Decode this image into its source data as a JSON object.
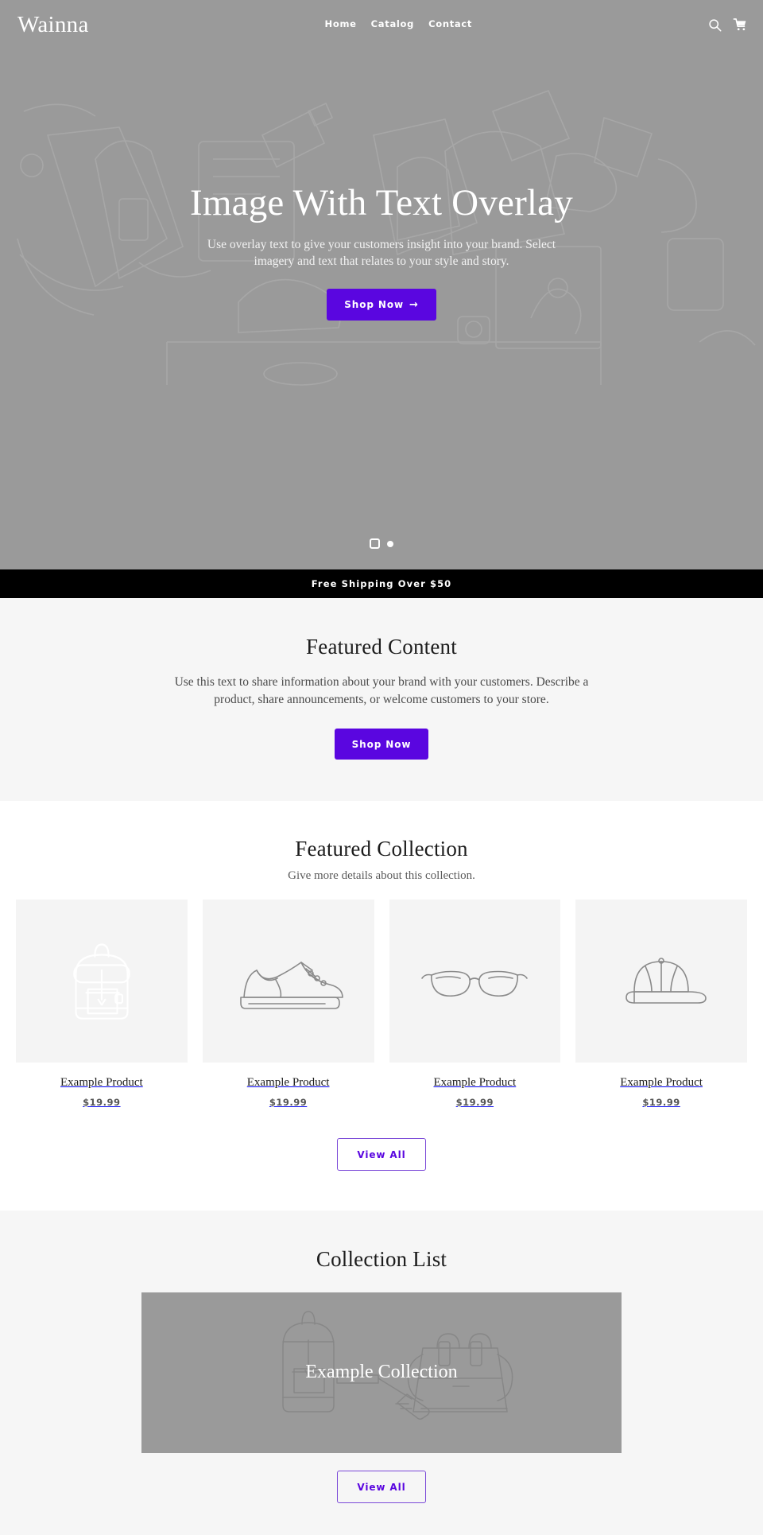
{
  "header": {
    "logo": "Wainna",
    "nav": [
      {
        "label": "Home",
        "name": "nav-link-home"
      },
      {
        "label": "Catalog",
        "name": "nav-link-catalog"
      },
      {
        "label": "Contact",
        "name": "nav-link-contact"
      }
    ],
    "search_icon": "search-icon",
    "cart_icon": "cart-icon"
  },
  "hero": {
    "title": "Image With Text Overlay",
    "subtitle": "Use overlay text to give your customers insight into your brand. Select imagery and text that relates to your style and story.",
    "cta_label": "Shop Now",
    "cta_arrow": "→",
    "slide_indicators": [
      "slide-1",
      "slide-2"
    ],
    "active_slide": 2
  },
  "announcement": {
    "text": "Free Shipping Over $50"
  },
  "featured_content": {
    "title": "Featured Content",
    "body": "Use this text to share information about your brand with your customers. Describe a product, share announcements, or welcome customers to your store.",
    "cta_label": "Shop Now"
  },
  "featured_collection": {
    "title": "Featured Collection",
    "subtitle": "Give more details about this collection.",
    "products": [
      {
        "title": "Example Product",
        "price": "$19.99",
        "art": "backpack"
      },
      {
        "title": "Example Product",
        "price": "$19.99",
        "art": "sneaker"
      },
      {
        "title": "Example Product",
        "price": "$19.99",
        "art": "glasses"
      },
      {
        "title": "Example Product",
        "price": "$19.99",
        "art": "cap"
      }
    ],
    "cta_label": "View All"
  },
  "collection_list": {
    "title": "Collection List",
    "card_label": "Example Collection",
    "cta_label": "View All"
  },
  "colors": {
    "accent": "#5a06e0",
    "accent_outline": "#7b49d8",
    "announcement_bg": "#000000",
    "hero_bg": "#9a9a9a",
    "section_gray": "#f6f6f6",
    "media_bg": "#f4f4f4"
  }
}
